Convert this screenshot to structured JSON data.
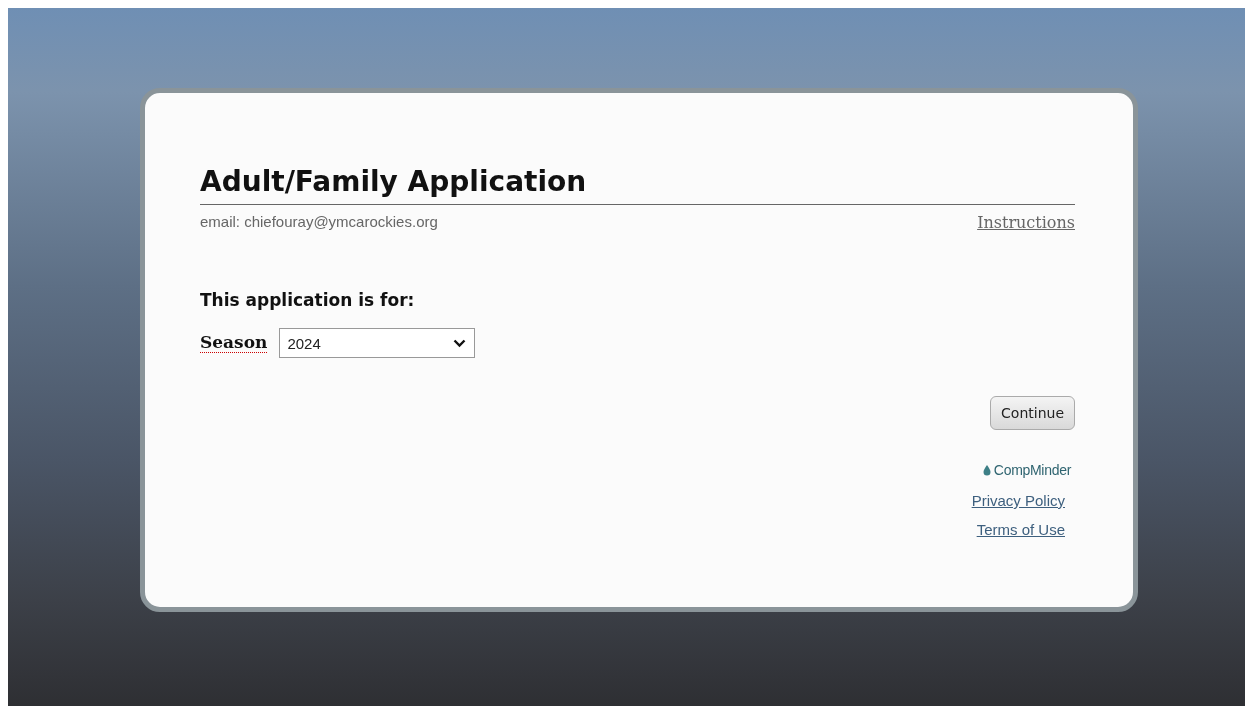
{
  "application": {
    "title": "Adult/Family Application",
    "email": "email: chiefouray@ymcarockies.org",
    "instructions_link": "Instructions",
    "section_heading": "This application is for:",
    "season": {
      "label": "Season",
      "value": "2024"
    },
    "continue_button": "Continue",
    "brand": "CompMinder",
    "footer_links": [
      "Privacy Policy",
      "Terms of Use"
    ]
  }
}
